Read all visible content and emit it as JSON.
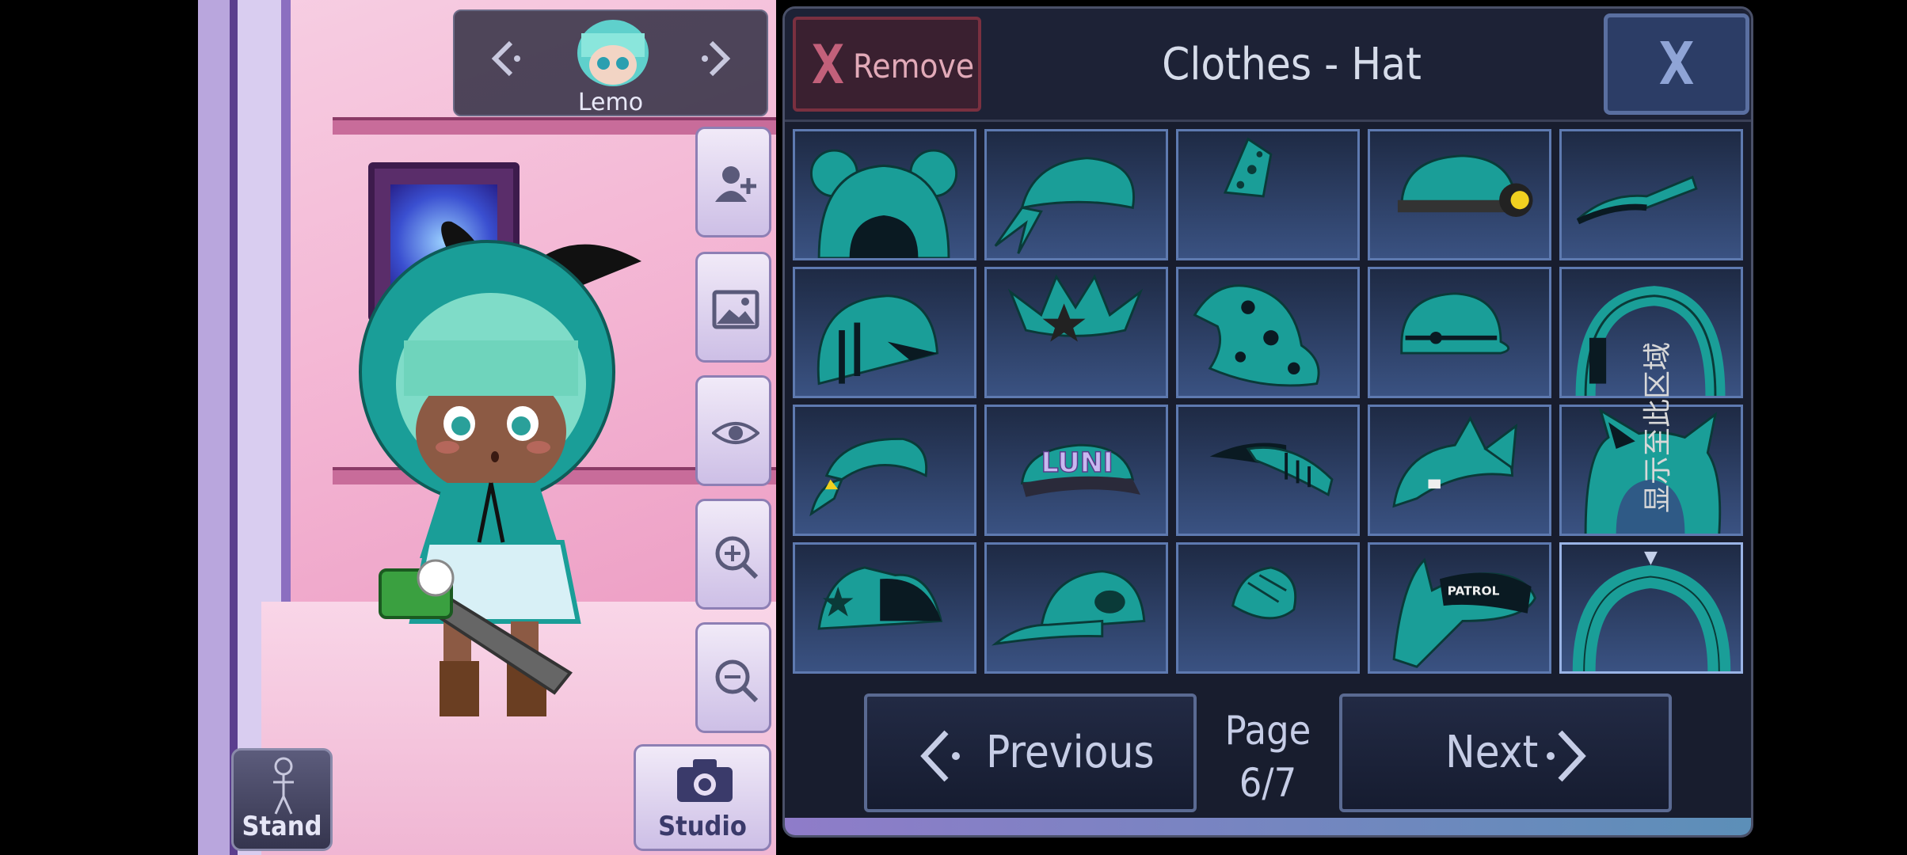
{
  "character_nav": {
    "name": "Lemo",
    "prev_icon": "chevron-left-icon",
    "next_icon": "chevron-right-icon"
  },
  "side_buttons": [
    {
      "name": "add-character-button",
      "icon": "add-person-icon"
    },
    {
      "name": "background-button",
      "icon": "image-icon"
    },
    {
      "name": "visibility-button",
      "icon": "eye-icon"
    },
    {
      "name": "zoom-in-button",
      "icon": "zoom-in-icon"
    },
    {
      "name": "zoom-out-button",
      "icon": "zoom-out-icon"
    }
  ],
  "stand_button": {
    "label": "Stand",
    "icon": "stand-figure-icon"
  },
  "studio_button": {
    "label": "Studio",
    "icon": "camera-icon"
  },
  "panel": {
    "remove_label": "Remove",
    "remove_x": "X",
    "title": "Clothes - Hat",
    "close_label": "X"
  },
  "hats": [
    "bear-ear-hood",
    "bandana",
    "polka-dot-party-hat",
    "miner-helmet",
    "visor",
    "striped-cap",
    "star-crown",
    "polka-dot-witch-hat",
    "bowler-hat",
    "headphone-hood",
    "baseball-cap",
    "luni-cap",
    "sport-cap",
    "cat-ear-cap",
    "cat-ear-hood",
    "star-cat-cap",
    "backward-cap",
    "small-beret",
    "patrol-cap-with-ears",
    "plain-hood"
  ],
  "selected_hat_index": 19,
  "pagination": {
    "previous_label": "Previous",
    "next_label": "Next",
    "page_word": "Page",
    "page_value": "6/7"
  },
  "side_text": "显示至此区域",
  "colors": {
    "accent_teal": "#1a9e98",
    "panel_bg": "#181d2e",
    "cell_border": "#5e7ab0",
    "remove_red": "#c2607a"
  }
}
